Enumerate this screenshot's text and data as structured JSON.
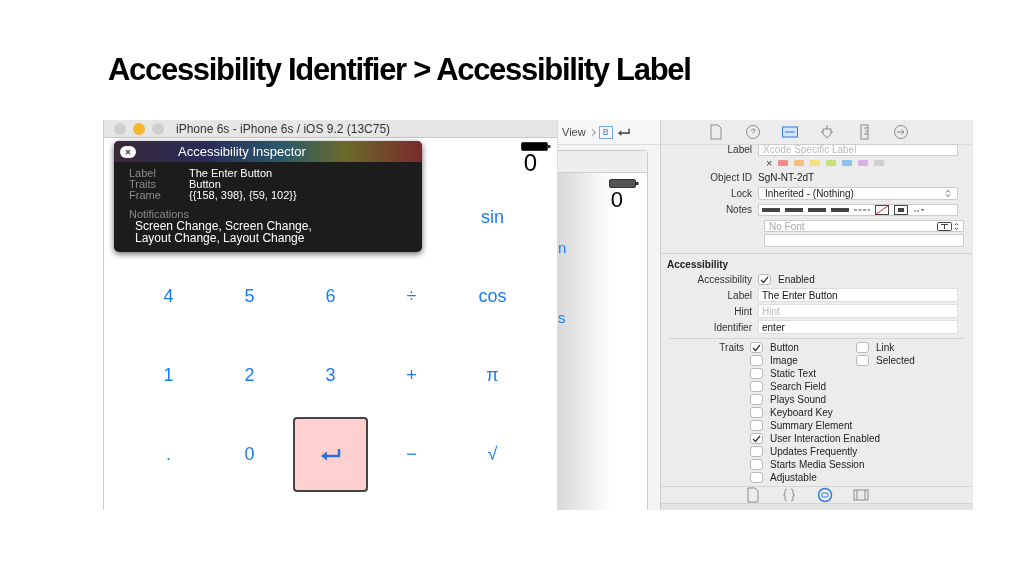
{
  "slide_title": "Accessibility Identifier > Accessibility Label",
  "simulator": {
    "title": "iPhone 6s - iPhone 6s / iOS 9.2 (13C75)",
    "display": "0",
    "key_rows": [
      [
        {
          "label": "sin",
          "kind": "text"
        }
      ],
      [
        {
          "label": "4",
          "kind": "text"
        },
        {
          "label": "5",
          "kind": "text"
        },
        {
          "label": "6",
          "kind": "text"
        },
        {
          "label": "÷",
          "kind": "text"
        },
        {
          "label": "cos",
          "kind": "text"
        }
      ],
      [
        {
          "label": "1",
          "kind": "text"
        },
        {
          "label": "2",
          "kind": "text"
        },
        {
          "label": "3",
          "kind": "text"
        },
        {
          "label": "+",
          "kind": "text"
        },
        {
          "label": "π",
          "kind": "text"
        }
      ],
      [
        {
          "label": ".",
          "kind": "text"
        },
        {
          "label": "0",
          "kind": "text"
        },
        {
          "kind": "enter",
          "highlighted": true
        },
        {
          "label": "−",
          "kind": "text"
        },
        {
          "label": "√",
          "kind": "text"
        }
      ]
    ]
  },
  "accessibility_inspector": {
    "title": "Accessibility Inspector",
    "fields": [
      {
        "label": "Label",
        "value": "The Enter Button"
      },
      {
        "label": "Traits",
        "value": "Button"
      },
      {
        "label": "Frame",
        "value": "{{158, 398}, {59, 102}}"
      }
    ],
    "notifications_label": "Notifications",
    "notifications": [
      "Screen Change, Screen Change,",
      "Layout Change, Layout Change"
    ]
  },
  "storyboard": {
    "breadcrumb": "View",
    "scene_badge": "B",
    "display": "0",
    "partial_keys": [
      "n",
      "s"
    ]
  },
  "identity_inspector": {
    "tabs": [
      {
        "kind": "file",
        "selected": false
      },
      {
        "kind": "help",
        "selected": false
      },
      {
        "kind": "identity",
        "selected": true
      },
      {
        "kind": "attributes",
        "selected": false
      },
      {
        "kind": "size",
        "selected": false
      },
      {
        "kind": "connections",
        "selected": false
      }
    ],
    "label_label": "Label",
    "label_placeholder": "Xcode Specific Label",
    "clear_tag": "×",
    "tags": [
      {
        "color": "#f28b8b"
      },
      {
        "color": "#f5c07a"
      },
      {
        "color": "#f2e27a"
      },
      {
        "color": "#c8e07a"
      },
      {
        "color": "#8ec0f0"
      },
      {
        "color": "#d9b0e8"
      },
      {
        "color": "#cfcfcf"
      }
    ],
    "object_id_label": "Object ID",
    "object_id": "SgN-NT-2dT",
    "lock_label": "Lock",
    "lock_value": "Inherited - (Nothing)",
    "notes_label": "Notes",
    "font_placeholder": "No Font",
    "section_title": "Accessibility",
    "enabled_label": "Accessibility",
    "enabled_text": "Enabled",
    "enabled": true,
    "fields": [
      {
        "label": "Label",
        "value": "The Enter Button"
      },
      {
        "label": "Hint",
        "placeholder": "Hint"
      },
      {
        "label": "Identifier",
        "value": "enter"
      }
    ],
    "traits_label": "Traits",
    "traits": [
      {
        "label": "Button",
        "checked": true
      },
      {
        "label": "Image",
        "checked": false
      },
      {
        "label": "Static Text",
        "checked": false
      },
      {
        "label": "Search Field",
        "checked": false
      },
      {
        "label": "Plays Sound",
        "checked": false
      },
      {
        "label": "Keyboard Key",
        "checked": false
      },
      {
        "label": "Summary Element",
        "checked": false
      },
      {
        "label": "User Interaction Enabled",
        "checked": true
      },
      {
        "label": "Updates Frequently",
        "checked": false
      },
      {
        "label": "Starts Media Session",
        "checked": false
      },
      {
        "label": "Adjustable",
        "checked": false
      }
    ],
    "traits_side": [
      {
        "label": "Link",
        "checked": false
      },
      {
        "label": "Selected",
        "checked": false
      }
    ],
    "bottom_tabs": [
      {
        "kind": "file",
        "selected": false
      },
      {
        "kind": "code",
        "selected": false
      },
      {
        "kind": "object",
        "selected": true
      },
      {
        "kind": "media",
        "selected": false
      }
    ]
  }
}
